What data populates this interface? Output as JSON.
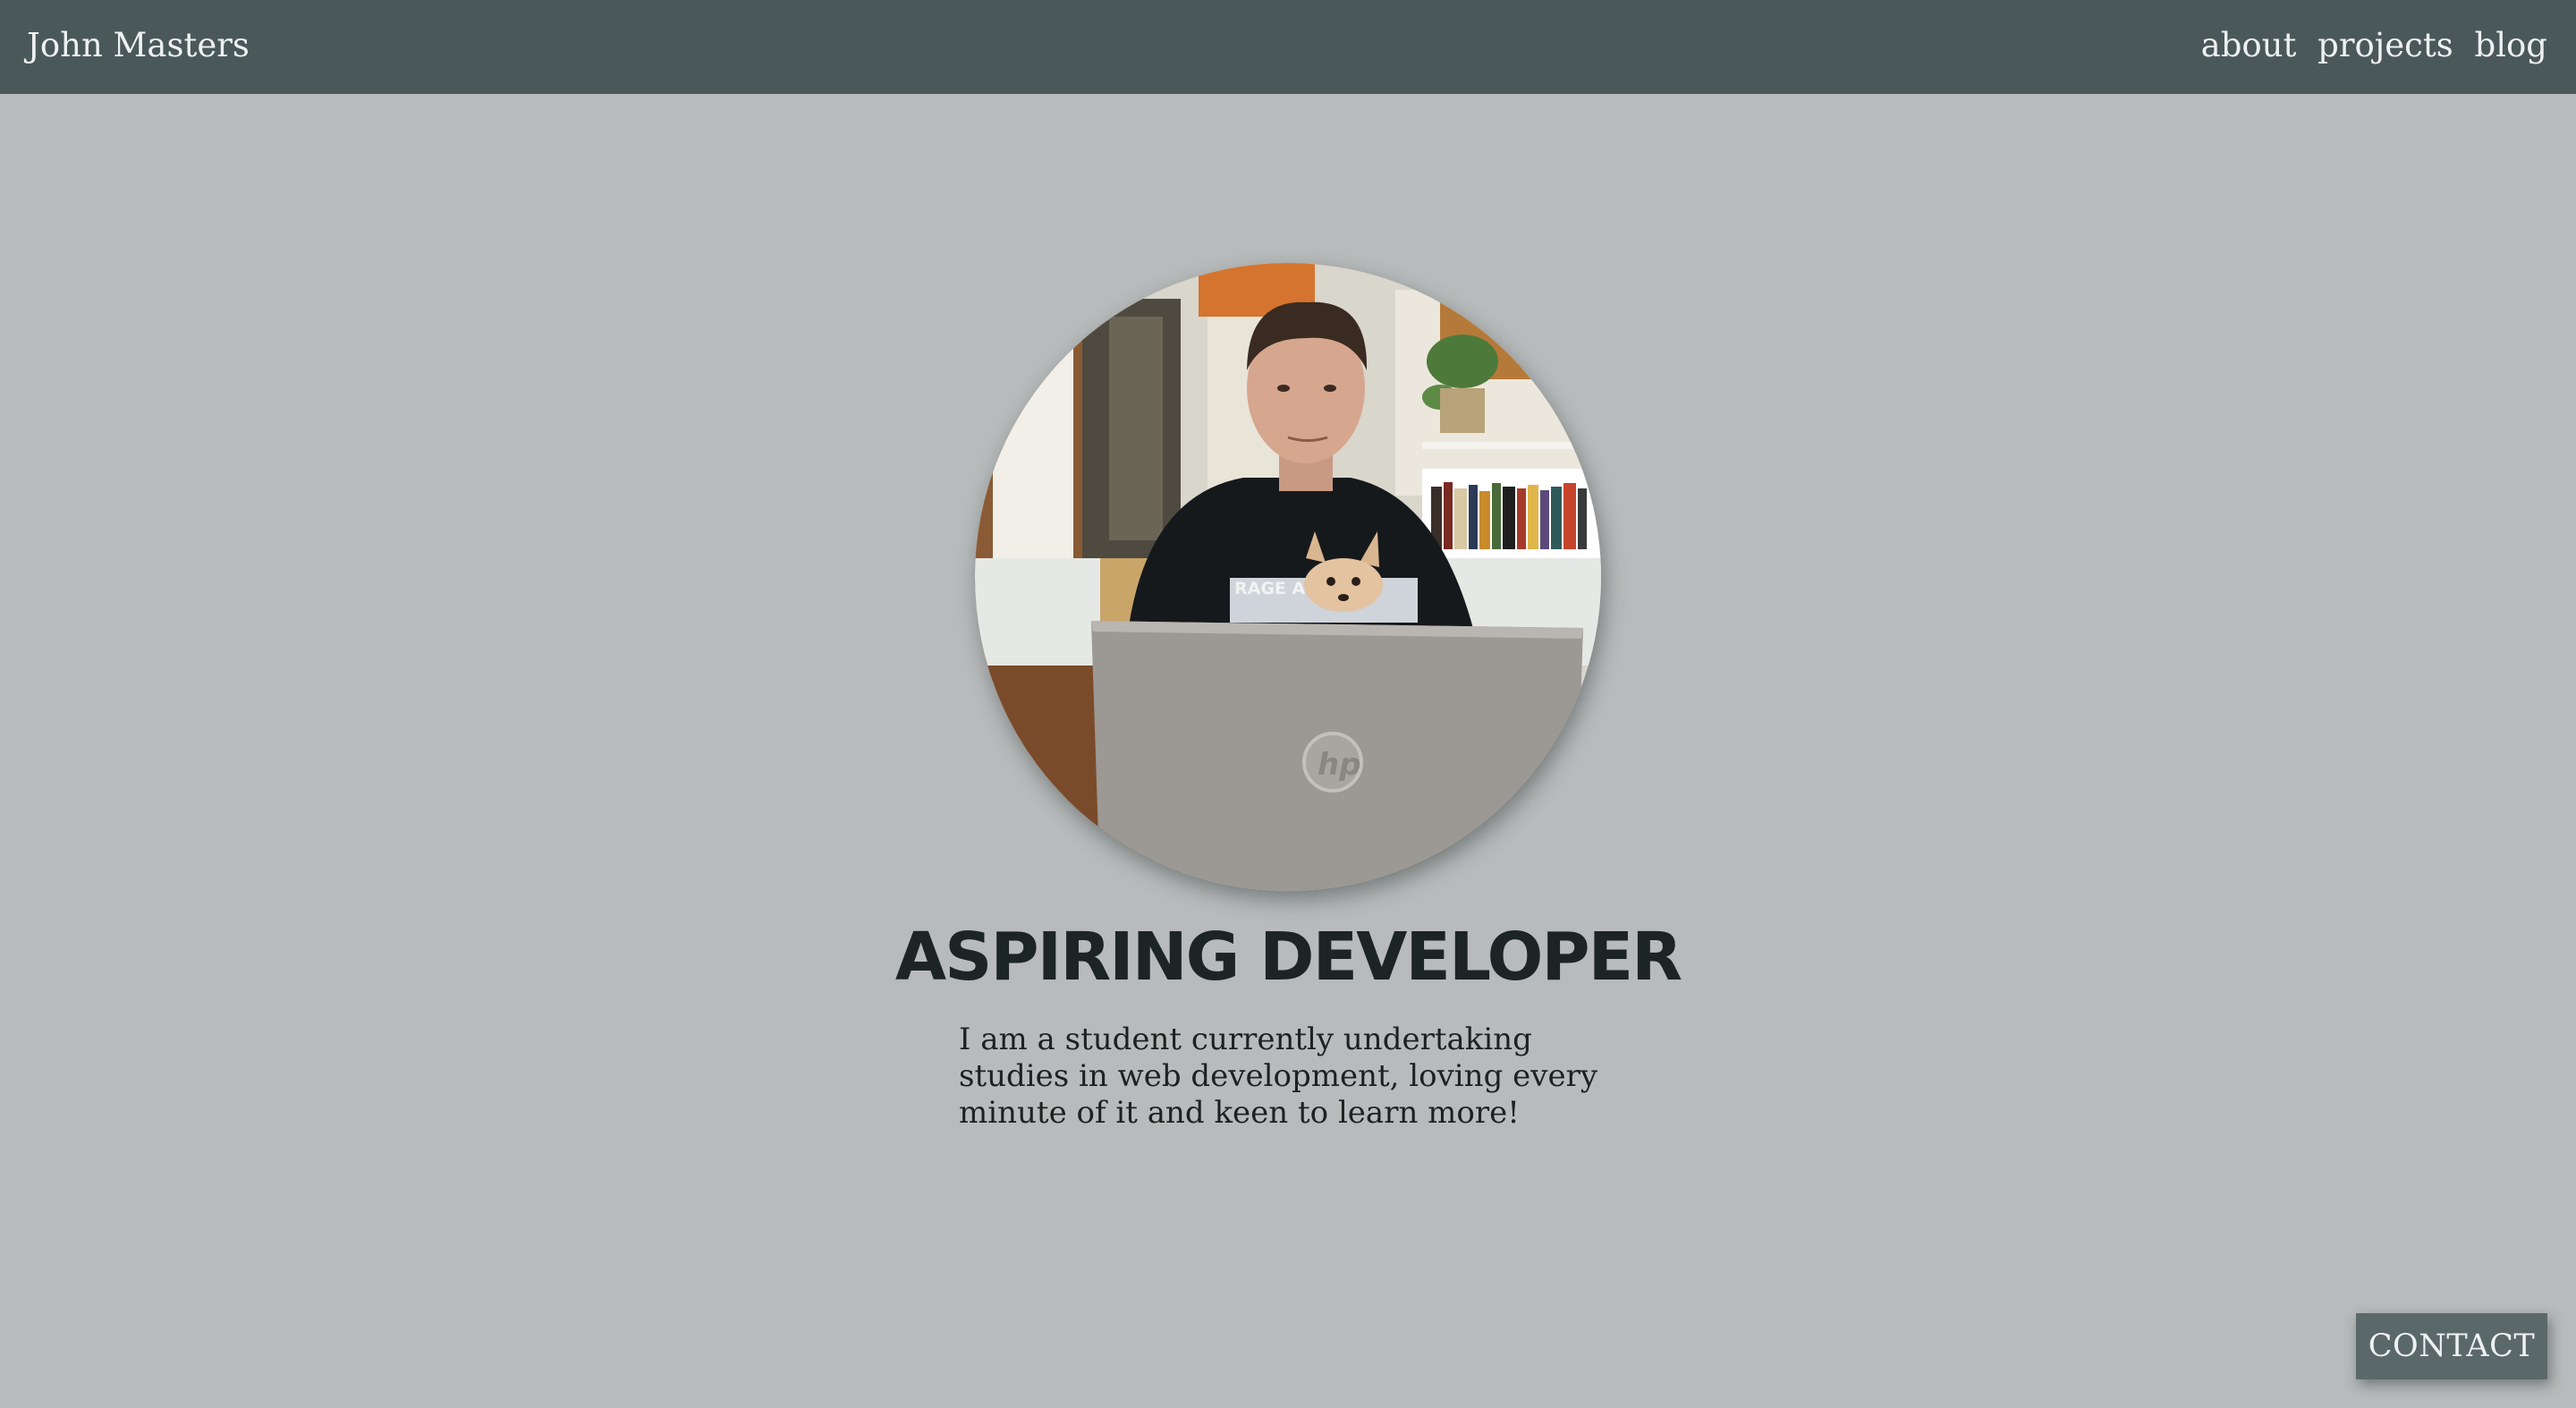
{
  "header": {
    "brand": "John Masters",
    "nav": [
      {
        "label": "about"
      },
      {
        "label": "projects"
      },
      {
        "label": "blog"
      }
    ]
  },
  "hero": {
    "photo": {
      "shirt_text": "RAGE AGAINST",
      "laptop_logo": "hp"
    },
    "headline": "ASPIRING DEVELOPER",
    "bio": "I am a student currently undertaking studies in web development, loving every minute of it and keen to learn more!"
  },
  "contact": {
    "label": "CONTACT"
  },
  "colors": {
    "background": "#b8bbbb",
    "navbar": "#4b5859",
    "nav_text": "#eef1f1",
    "headline": "#1c2524",
    "contact_button": "#5b6869"
  }
}
